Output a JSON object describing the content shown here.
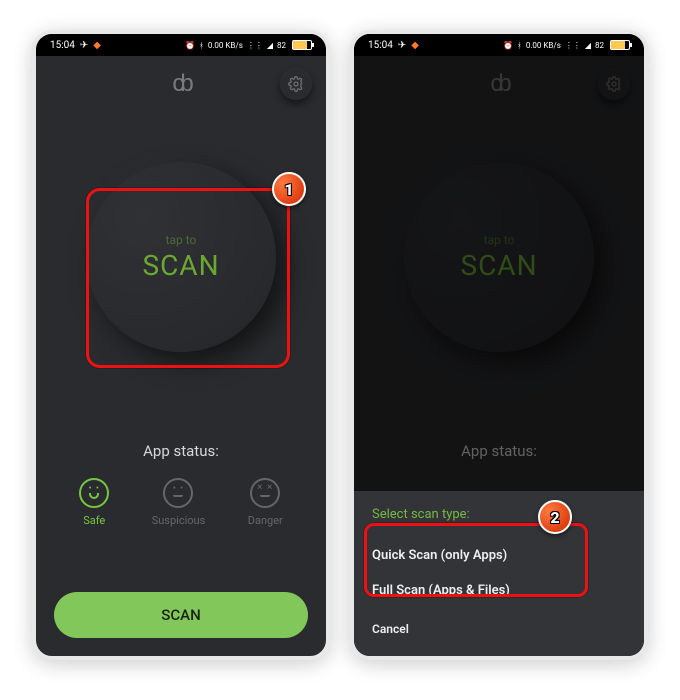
{
  "status": {
    "time": "15:04",
    "net_speed": "0.00 KB/s",
    "batt": "82"
  },
  "scan_circle": {
    "tap": "tap to",
    "scan": "SCAN"
  },
  "app_status_label": "App status:",
  "statuses": {
    "safe": "Safe",
    "suspicious": "Suspicious",
    "danger": "Danger"
  },
  "scan_button": "SCAN",
  "sheet": {
    "title": "Select scan type:",
    "quick": "Quick Scan (only Apps)",
    "full": "Full Scan (Apps & Files)",
    "cancel": "Cancel"
  },
  "badges": {
    "one": "1",
    "two": "2"
  }
}
